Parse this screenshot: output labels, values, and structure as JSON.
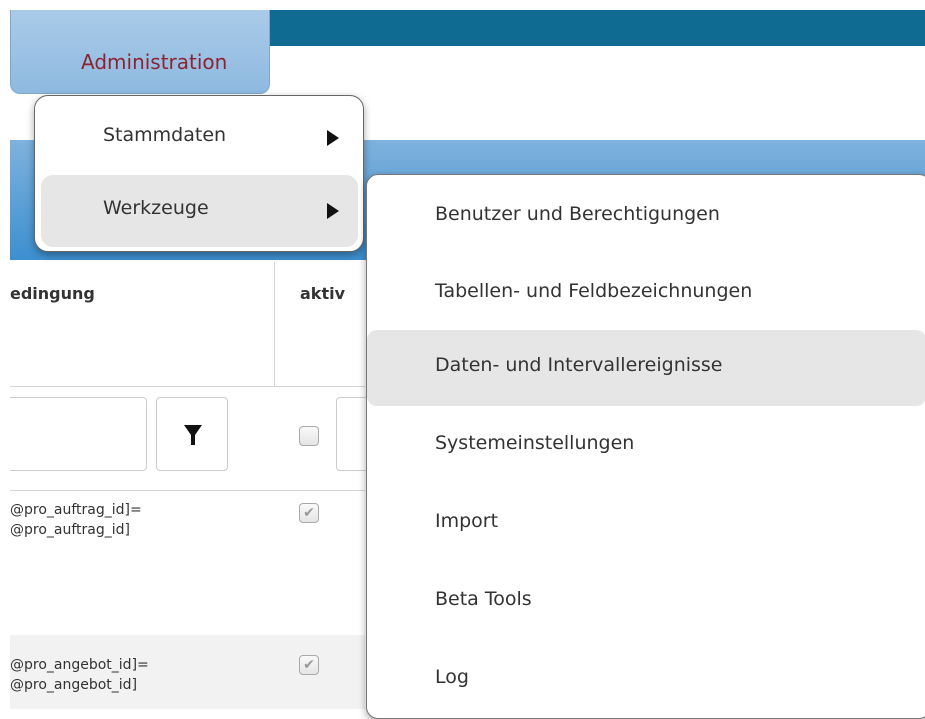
{
  "topnav": {
    "admin_label": "Administration"
  },
  "grid": {
    "columns": [
      {
        "label": "edingung"
      },
      {
        "label": "aktiv"
      }
    ],
    "rows": [
      {
        "condition": "@pro_auftrag_id]=\n@pro_auftrag_id]",
        "active": true
      },
      {
        "condition": "@pro_angebot_id]=\n@pro_angebot_id]",
        "active": true
      }
    ]
  },
  "menu": {
    "items": [
      {
        "label": "Stammdaten",
        "has_submenu": true,
        "highlighted": false
      },
      {
        "label": "Werkzeuge",
        "has_submenu": true,
        "highlighted": true
      }
    ]
  },
  "submenu": {
    "items": [
      {
        "label": "Benutzer und Berechtigungen",
        "highlighted": false
      },
      {
        "label": "Tabellen- und Feldbezeichnungen",
        "highlighted": false
      },
      {
        "label": "Daten- und Intervallereignisse",
        "highlighted": true
      },
      {
        "label": "Systemeinstellungen",
        "highlighted": false
      },
      {
        "label": "Import",
        "highlighted": false
      },
      {
        "label": "Beta Tools",
        "highlighted": false
      },
      {
        "label": "Log",
        "highlighted": false
      }
    ]
  },
  "colors": {
    "topbar": "#0f6b92",
    "tab_bg": "#a9cbe8",
    "admin_text": "#8c2330",
    "grid_header": "#3c8fd0",
    "hover": "#e6e6e6"
  },
  "icons": [
    "funnel-filter-icon",
    "submenu-arrow-icon",
    "checkmark-icon"
  ]
}
